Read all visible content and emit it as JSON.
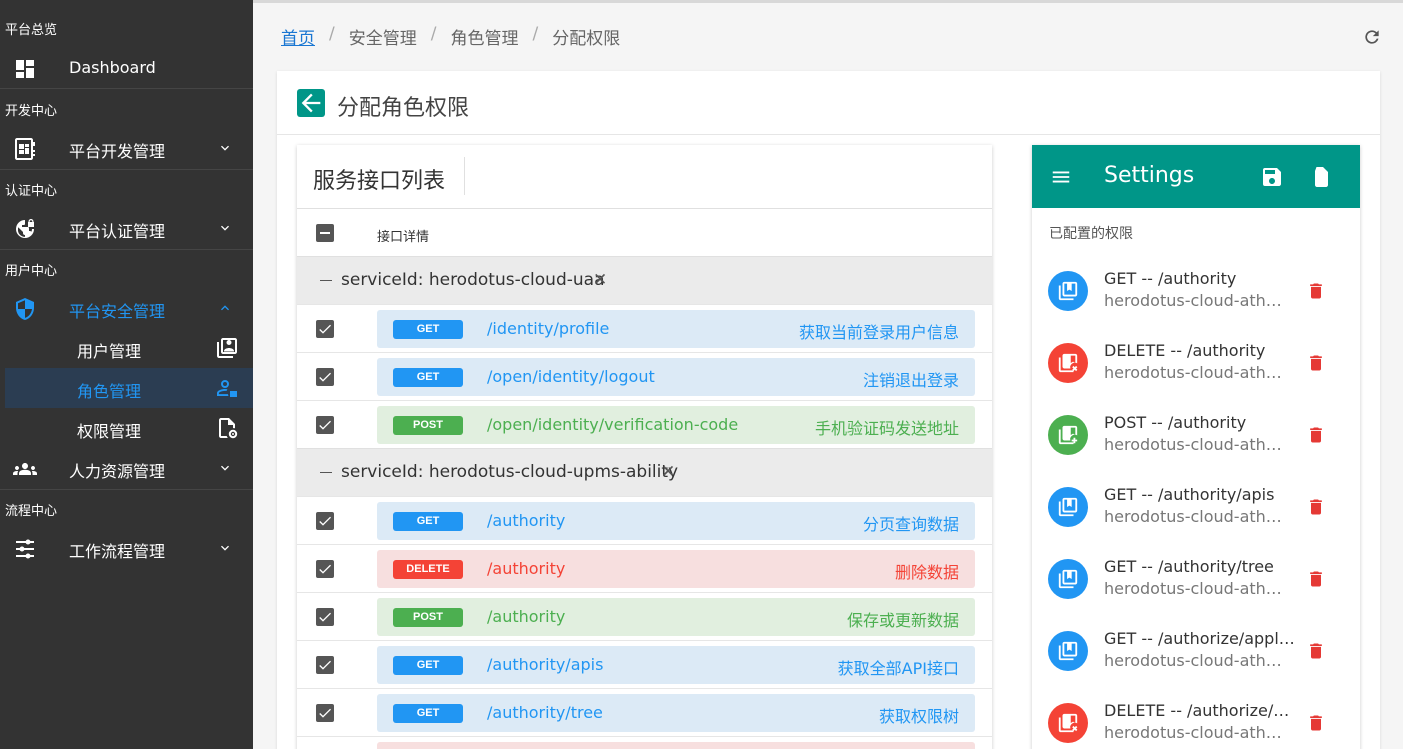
{
  "sidebar": {
    "sections": [
      {
        "title": "平台总览"
      },
      {
        "title": "开发中心"
      },
      {
        "title": "认证中心"
      },
      {
        "title": "用户中心"
      },
      {
        "title": "流程中心"
      }
    ],
    "items": {
      "dashboard": "Dashboard",
      "dev": "平台开发管理",
      "auth": "平台认证管理",
      "security": "平台安全管理",
      "user_mgmt": "用户管理",
      "role_mgmt": "角色管理",
      "perm_mgmt": "权限管理",
      "hr": "人力资源管理",
      "workflow": "工作流程管理"
    }
  },
  "breadcrumb": {
    "home": "首页",
    "security": "安全管理",
    "role": "角色管理",
    "current": "分配权限",
    "separator": "/"
  },
  "page": {
    "title": "分配角色权限"
  },
  "service_panel": {
    "title": "服务接口列表",
    "header_label": "接口详情",
    "groups": [
      {
        "label": "serviceId: herodotus-cloud-uaa",
        "rows": [
          {
            "method": "GET",
            "path": "/identity/profile",
            "desc": "获取当前登录用户信息"
          },
          {
            "method": "GET",
            "path": "/open/identity/logout",
            "desc": "注销退出登录"
          },
          {
            "method": "POST",
            "path": "/open/identity/verification-code",
            "desc": "手机验证码发送地址"
          }
        ]
      },
      {
        "label": "serviceId: herodotus-cloud-upms-ability",
        "rows": [
          {
            "method": "GET",
            "path": "/authority",
            "desc": "分页查询数据"
          },
          {
            "method": "DELETE",
            "path": "/authority",
            "desc": "删除数据"
          },
          {
            "method": "POST",
            "path": "/authority",
            "desc": "保存或更新数据"
          },
          {
            "method": "GET",
            "path": "/authority/apis",
            "desc": "获取全部API接口"
          },
          {
            "method": "GET",
            "path": "/authority/tree",
            "desc": "获取权限树"
          }
        ]
      }
    ]
  },
  "settings": {
    "title": "Settings",
    "subheader": "已配置的权限",
    "items": [
      {
        "line1": "GET -- /authority",
        "line2": "herodotus-cloud-ath…",
        "method": "GET"
      },
      {
        "line1": "DELETE -- /authority",
        "line2": "herodotus-cloud-ath…",
        "method": "DELETE"
      },
      {
        "line1": "POST -- /authority",
        "line2": "herodotus-cloud-ath…",
        "method": "POST"
      },
      {
        "line1": "GET -- /authority/apis",
        "line2": "herodotus-cloud-ath…",
        "method": "GET"
      },
      {
        "line1": "GET -- /authority/tree",
        "line2": "herodotus-cloud-ath…",
        "method": "GET"
      },
      {
        "line1": "GET -- /authorize/appl…",
        "line2": "herodotus-cloud-ath…",
        "method": "GET"
      },
      {
        "line1": "DELETE -- /authorize/…",
        "line2": "herodotus-cloud-ath…",
        "method": "DELETE"
      }
    ]
  },
  "colors": {
    "sidebar_bg": "#333333",
    "accent_teal": "#009688",
    "get": "#2196f3",
    "post": "#4caf50",
    "delete": "#f44336",
    "delete_icon": "#e53935"
  }
}
